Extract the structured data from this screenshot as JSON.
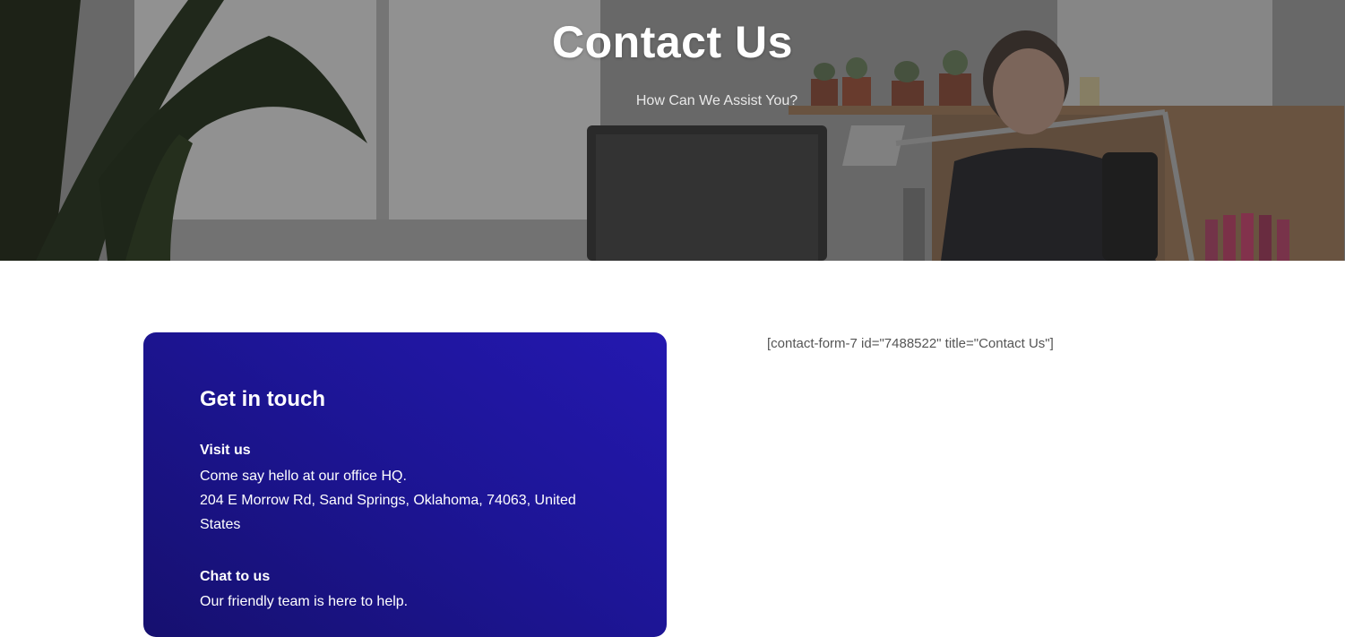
{
  "hero": {
    "title": "Contact Us",
    "subtitle": "How Can We Assist You?"
  },
  "card": {
    "heading": "Get in touch",
    "visit": {
      "title": "Visit us",
      "line1": "Come say hello at our office HQ.",
      "address": "204 E Morrow Rd, Sand Springs, Oklahoma, 74063, United States"
    },
    "chat": {
      "title": "Chat to us",
      "line1": "Our friendly team is here to help."
    }
  },
  "form": {
    "shortcode": "[contact-form-7 id=\"7488522\" title=\"Contact Us\"]"
  },
  "colors": {
    "card_gradient_start": "#2418b0",
    "card_gradient_end": "#16106f",
    "shortcode_text": "#555555"
  }
}
